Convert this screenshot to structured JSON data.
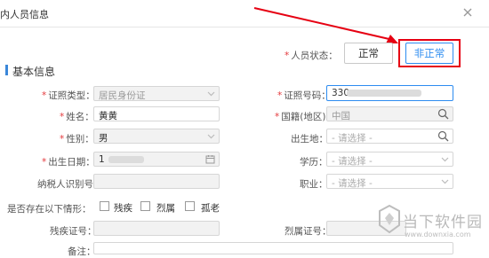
{
  "dialog": {
    "title": "内人员信息"
  },
  "status": {
    "label": "人员状态：",
    "normal_label": "正常",
    "abnormal_label": "非正常"
  },
  "section": {
    "title": "基本信息"
  },
  "form": {
    "id_type": {
      "label": "证照类型：",
      "value": "居民身份证"
    },
    "id_number": {
      "label": "证照号码：",
      "value": "330"
    },
    "name": {
      "label": "姓名：",
      "value": "黄黄"
    },
    "nationality": {
      "label": "国籍(地区)：",
      "value": "中国"
    },
    "gender": {
      "label": "性别：",
      "value": "男"
    },
    "birthplace": {
      "label": "出生地：",
      "placeholder": "- 请选择 -"
    },
    "birthdate": {
      "label": "出生日期：",
      "value": "1"
    },
    "education": {
      "label": "学历：",
      "placeholder": "- 请选择 -"
    },
    "taxpayer_id": {
      "label": "纳税人识别号：",
      "value": ""
    },
    "occupation": {
      "label": "职业：",
      "placeholder": "- 请选择 -"
    },
    "situations": {
      "label": "是否存在以下情形：",
      "options": [
        "残疾",
        "烈属",
        "孤老"
      ]
    },
    "disability_cert": {
      "label": "残疾证号：",
      "value": ""
    },
    "martyr_cert": {
      "label": "烈属证号：",
      "value": ""
    },
    "remarks": {
      "label": "备注："
    }
  },
  "watermark": {
    "title": "当下软件园",
    "url": "www.downxia.com"
  },
  "colors": {
    "accent": "#2d8cf0",
    "highlight": "#e60012",
    "required": "#e4393c"
  }
}
